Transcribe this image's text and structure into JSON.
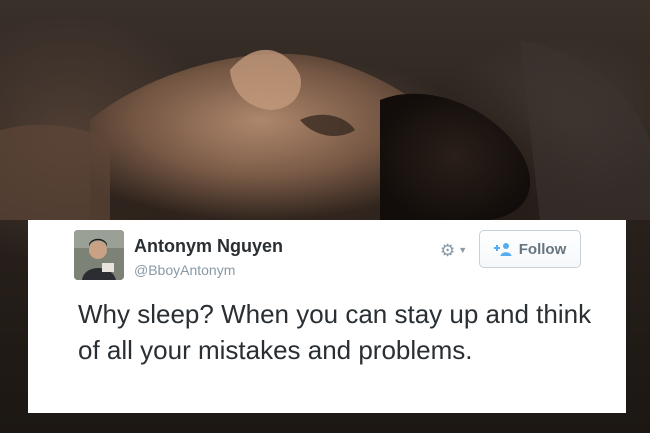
{
  "tweet": {
    "display_name": "Antonym Nguyen",
    "handle": "@BboyAntonym",
    "text": "Why sleep? When you can stay up and think of all your mistakes and problems.",
    "follow_label": "Follow"
  },
  "icons": {
    "gear": "gear-icon",
    "chevron": "chevron-down-icon",
    "follow": "follow-person-plus-icon"
  },
  "colors": {
    "name": "#292f33",
    "handle": "#8899a6",
    "follow_accent": "#55acee",
    "follow_label": "#66757f",
    "card_background": "#ffffff"
  }
}
